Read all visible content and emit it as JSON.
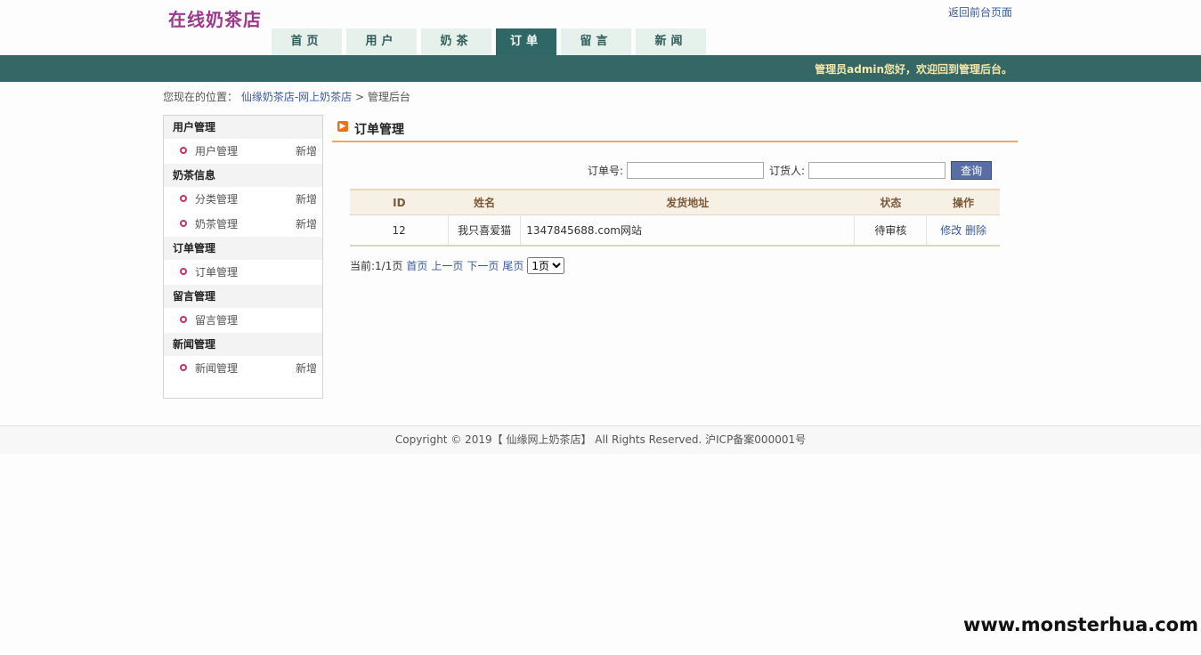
{
  "header": {
    "site_title": "在线奶茶店",
    "top_link": "返回前台页面",
    "nav": [
      "首页",
      "用户",
      "奶茶",
      "订单",
      "留言",
      "新闻"
    ],
    "nav_active": "订单",
    "welcome": "管理员admin您好，欢迎回到管理后台。"
  },
  "breadcrumb": {
    "prefix": "您现在的位置：",
    "link": "仙缘奶茶店-网上奶茶店",
    "sep": ">",
    "current": "管理后台"
  },
  "sidebar": {
    "groups": [
      {
        "title": "用户管理",
        "items": [
          {
            "label": "用户管理",
            "add": "新增"
          }
        ]
      },
      {
        "title": "奶茶信息",
        "items": [
          {
            "label": "分类管理",
            "add": "新增"
          },
          {
            "label": "奶茶管理",
            "add": "新增"
          }
        ]
      },
      {
        "title": "订单管理",
        "items": [
          {
            "label": "订单管理",
            "add": ""
          }
        ]
      },
      {
        "title": "留言管理",
        "items": [
          {
            "label": "留言管理",
            "add": ""
          }
        ]
      },
      {
        "title": "新闻管理",
        "items": [
          {
            "label": "新闻管理",
            "add": "新增"
          }
        ]
      }
    ]
  },
  "panel": {
    "title": "订单管理"
  },
  "search": {
    "order_no_label": "订单号:",
    "order_no_value": "",
    "buyer_label": "订货人:",
    "buyer_value": "",
    "button": "查询"
  },
  "table": {
    "headers": [
      "ID",
      "姓名",
      "发货地址",
      "状态",
      "操作"
    ],
    "rows": [
      {
        "id": "12",
        "name": "我只喜爱猫",
        "address": "1347845688.com网站",
        "status": "待审核",
        "edit": "修改",
        "delete": "删除"
      }
    ]
  },
  "pager": {
    "info": "当前:1/1页",
    "first": "首页",
    "prev": "上一页",
    "next": "下一页",
    "last": "尾页",
    "select_value": "1页"
  },
  "footer": {
    "text": "Copyright © 2019【 仙缘网上奶茶店】 All Rights Reserved. 沪ICP备案000001号"
  },
  "watermark": "www.monsterhua.com",
  "colors": {
    "brand_title": "#9b3a8b",
    "banner": "#356766",
    "nav_tab": "#e5f1ea",
    "accent_line": "#f0a65e"
  }
}
